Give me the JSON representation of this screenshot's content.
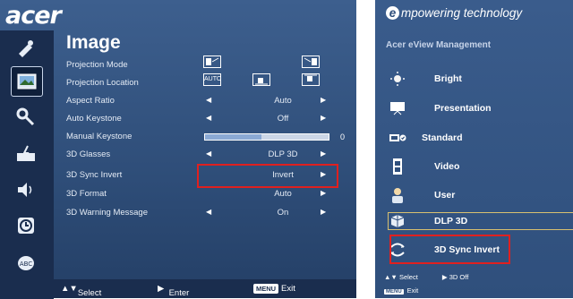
{
  "left": {
    "brand": "acer",
    "page_title": "Image",
    "rows": [
      {
        "label": "Projection Mode",
        "value": ""
      },
      {
        "label": "Projection Location",
        "value": ""
      },
      {
        "label": "Aspect Ratio",
        "value": "Auto"
      },
      {
        "label": "Auto Keystone",
        "value": "Off"
      },
      {
        "label": "Manual Keystone",
        "value": "0"
      },
      {
        "label": "3D Glasses",
        "value": "DLP 3D"
      },
      {
        "label": "3D Sync Invert",
        "value": "Invert"
      },
      {
        "label": "3D Format",
        "value": "Auto"
      },
      {
        "label": "3D Warning Message",
        "value": "On"
      }
    ],
    "projection_location_mode": "AUTO",
    "keystone_fill": 0.46,
    "footer": {
      "select": "Select",
      "enter": "Enter",
      "menu_key": "MENU",
      "exit": "Exit"
    }
  },
  "right": {
    "tagline_e": "e",
    "tagline": "mpowering technology",
    "title": "Acer eView Management",
    "modes": [
      {
        "label": "Bright",
        "icon": "sun-icon"
      },
      {
        "label": "Presentation",
        "icon": "presentation-icon"
      },
      {
        "label": "Standard",
        "icon": "standard-icon"
      },
      {
        "label": "Video",
        "icon": "film-icon"
      },
      {
        "label": "User",
        "icon": "user-icon"
      },
      {
        "label": "DLP 3D",
        "icon": "cube-icon"
      },
      {
        "label": "3D Sync Invert",
        "icon": "sync-invert-icon"
      }
    ],
    "footer": {
      "select": "Select",
      "value": "3D Off",
      "menu_key": "MENU",
      "exit": "Exit"
    }
  },
  "colors": {
    "panel": "#2e4d78",
    "sidebar": "#1a2d4e",
    "highlight": "#e0201f"
  }
}
